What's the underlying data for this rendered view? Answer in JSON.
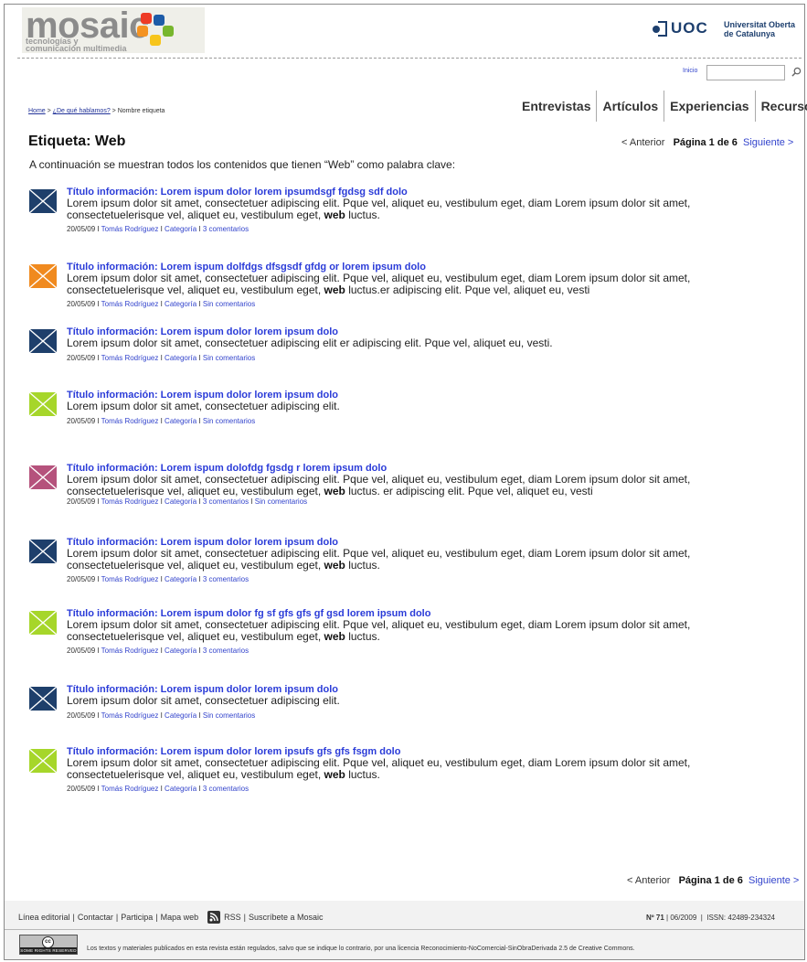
{
  "header": {
    "logo_word": "mosaic",
    "logo_sub_line1": "tecnologías y",
    "logo_sub_line2": "comunicación multimedia",
    "logo_colors": [
      "#ee3b26",
      "#f49322",
      "#1e5ca8",
      "#77b62d",
      "#f7c51c"
    ],
    "uoc_word": "UOC",
    "uoc_name_line1": "Universitat Oberta",
    "uoc_name_line2": "de Catalunya",
    "inicio_label": "Inicio",
    "search_value": "",
    "search_icon": "magnifier-icon"
  },
  "breadcrumb": {
    "home": "Home",
    "sep1": " > ",
    "section": "¿De qué hablamos?",
    "sep2": " > ",
    "current": "Nombre etiqueta"
  },
  "nav": [
    "Entrevistas",
    "Artículos",
    "Experiencias",
    "Recursos"
  ],
  "page": {
    "heading": "Etiqueta: Web",
    "intro": "A continuación se muestran todos los contenidos que tienen “Web” como palabra clave:"
  },
  "pager": {
    "prev": "< Anterior",
    "page": "Página 1 de 6",
    "next": "Siguiente >"
  },
  "items": [
    {
      "color": "#1e3f6b",
      "title": "Título información: Lorem ispum dolor lorem ipsumdsgf fgdsg sdf dolo",
      "text_line1": "Lorem ipsum dolor sit amet, consectetuer adipiscing elit. Pque vel, aliquet eu, vestibulum eget, diam Lorem ipsum dolor sit amet,",
      "text_line2_pre": "consectetuelerisque vel, aliquet eu, vestibulum eget, ",
      "text_bold": "web",
      "text_line2_post": " luctus.",
      "date": "20/05/09",
      "author": "Tomás Rodríguez",
      "category": "Categoría",
      "comments": "3 comentarios"
    },
    {
      "color": "#f08a1f",
      "title": "Título información: Lorem ispum dolfdgs dfsgsdf gfdg or lorem ipsum dolo",
      "text_line1": "Lorem ipsum dolor sit amet, consectetuer adipiscing elit. Pque vel, aliquet eu, vestibulum eget, diam Lorem ipsum dolor sit amet,",
      "text_line2_pre": "consectetuelerisque vel, aliquet eu, vestibulum eget, ",
      "text_bold": "web",
      "text_line2_post": " luctus.er adipiscing elit. Pque vel, aliquet eu, vesti",
      "date": "20/05/09",
      "author": "Tomás Rodríguez",
      "category": "Categoría",
      "comments": "Sin  comentarios"
    },
    {
      "color": "#1e3f6b",
      "title": "Título información: Lorem ispum dolor lorem ipsum dolo",
      "text_line1": "Lorem ipsum dolor sit amet, consectetuer adipiscing elit er adipiscing elit. Pque vel, aliquet eu, vesti.",
      "date": "20/05/09",
      "author": "Tomás Rodríguez",
      "category": "Categoría",
      "comments": "Sin  comentarios"
    },
    {
      "color": "#a6d62a",
      "title": "Título información: Lorem ispum dolor lorem ipsum dolo",
      "text_line1": "Lorem ipsum dolor sit amet, consectetuer adipiscing elit.",
      "date": "20/05/09",
      "author": "Tomás Rodríguez",
      "category": "Categoría",
      "comments": "Sin  comentarios"
    },
    {
      "color": "#b5527c",
      "title": "Título información: Lorem ispum dolofdg fgsdg r lorem ipsum dolo",
      "text_line1": "Lorem ipsum dolor sit amet, consectetuer adipiscing elit. Pque vel, aliquet eu, vestibulum eget, diam Lorem ipsum dolor sit amet,",
      "text_line2_pre": "consectetuelerisque vel, aliquet eu, vestibulum eget, ",
      "text_bold": "web",
      "text_line2_post": " luctus. er adipiscing elit. Pque vel, aliquet eu, vesti",
      "date": "20/05/09",
      "author": "Tomás Rodríguez",
      "category": "Categoría",
      "comments": "3 comentarios",
      "comments2": "Sin  comentarios"
    },
    {
      "color": "#1e3f6b",
      "title": "Título información: Lorem ispum dolor lorem ipsum dolo",
      "text_line1": "Lorem ipsum dolor sit amet, consectetuer adipiscing elit. Pque vel, aliquet eu, vestibulum eget, diam Lorem ipsum dolor sit amet,",
      "text_line2_pre": "consectetuelerisque vel, aliquet eu, vestibulum eget, ",
      "text_bold": "web",
      "text_line2_post": " luctus.",
      "date": "20/05/09",
      "author": "Tomás Rodríguez",
      "category": "Categoría",
      "comments": "3 comentarios"
    },
    {
      "color": "#a6d62a",
      "title": "Título información: Lorem ispum dolor fg sf gfs gfs gf gsd lorem ipsum dolo",
      "text_line1": "Lorem ipsum dolor sit amet, consectetuer adipiscing elit. Pque vel, aliquet eu, vestibulum eget, diam Lorem ipsum dolor sit amet,",
      "text_line2_pre": "consectetuelerisque vel, aliquet eu, vestibulum eget, ",
      "text_bold": "web",
      "text_line2_post": " luctus.",
      "date": "20/05/09",
      "author": "Tomás Rodríguez",
      "category": "Categoría",
      "comments": "3 comentarios"
    },
    {
      "color": "#1e3f6b",
      "title": "Título información: Lorem ispum dolor lorem ipsum dolo",
      "text_line1": "Lorem ipsum dolor sit amet, consectetuer adipiscing elit.",
      "date": "20/05/09",
      "author": "Tomás Rodríguez",
      "category": "Categoría",
      "comments": "Sin  comentarios"
    },
    {
      "color": "#a6d62a",
      "title": "Título información: Lorem ispum dolor lorem ipsufs gfs gfs fsgm dolo",
      "text_line1": "Lorem ipsum dolor sit amet, consectetuer adipiscing elit. Pque vel, aliquet eu, vestibulum eget, diam Lorem ipsum dolor sit amet,",
      "text_line2_pre": "consectetuelerisque vel, aliquet eu, vestibulum eget, ",
      "text_bold": "web",
      "text_line2_post": " luctus.",
      "date": "20/05/09",
      "author": "Tomás Rodríguez",
      "category": "Categoría",
      "comments": "3 comentarios"
    }
  ],
  "footer": {
    "links": [
      "Línea editorial",
      "Contactar",
      "Participa",
      "Mapa web"
    ],
    "rss_label": "RSS",
    "subscribe": "Suscríbete a Mosaic",
    "issue_no": "Nº 71",
    "issue_date": "06/2009",
    "issn": "ISSN: 42489-234324",
    "cc_symbol": "cc",
    "cc_text": "SOME RIGHTS RESERVED",
    "license": "Los textos y materiales publicados en esta revista están regulados, salvo que se indique lo contrario, por una licencia Reconocimiento-NoComercial-SinObraDerivada 2.5 de Creative Commons."
  }
}
